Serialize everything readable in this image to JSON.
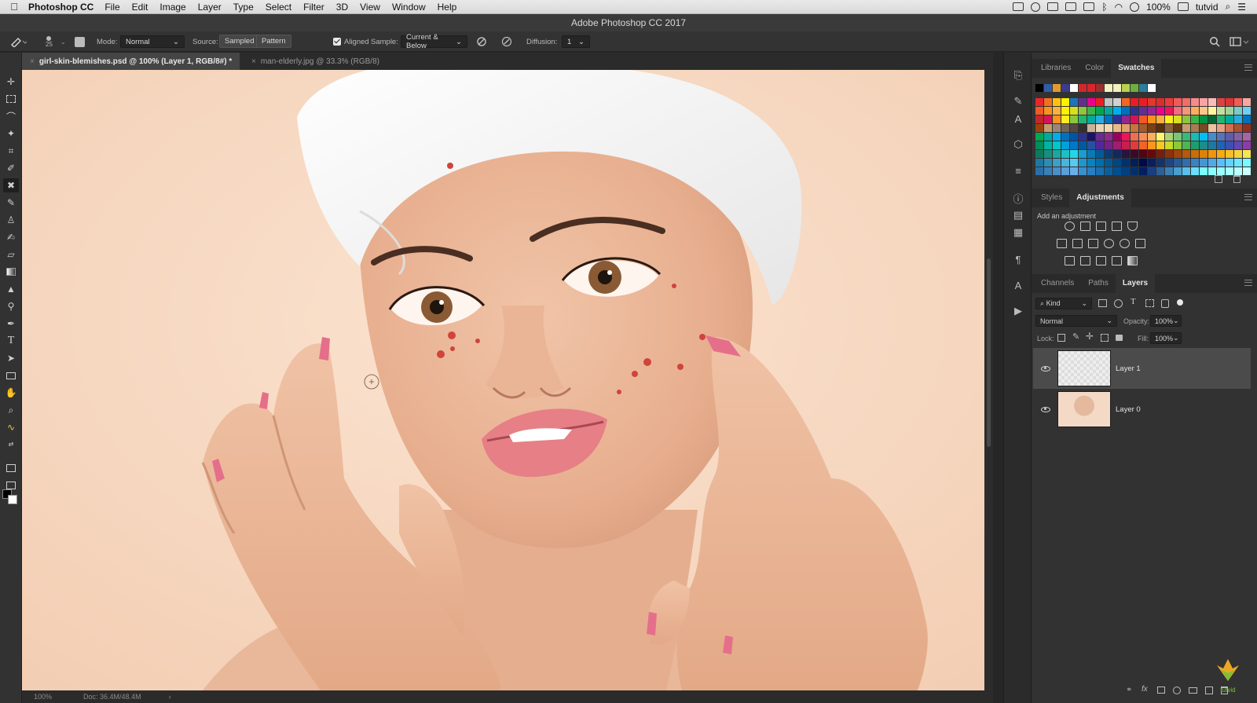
{
  "menubar": {
    "app_name": "Photoshop CC",
    "items": [
      "File",
      "Edit",
      "Image",
      "Layer",
      "Type",
      "Select",
      "Filter",
      "3D",
      "View",
      "Window",
      "Help"
    ],
    "battery": "100%",
    "user": "tutvid"
  },
  "window": {
    "title": "Adobe Photoshop CC 2017"
  },
  "options": {
    "brush_size": "25",
    "mode_label": "Mode:",
    "mode_value": "Normal",
    "source_label": "Source:",
    "source_sampled": "Sampled",
    "source_pattern": "Pattern",
    "aligned_label": "Aligned",
    "aligned_checked": true,
    "sample_label": "Sample:",
    "sample_value": "Current & Below",
    "diffusion_label": "Diffusion:",
    "diffusion_value": "1"
  },
  "tabs": [
    {
      "label": "girl-skin-blemishes.psd @ 100% (Layer 1, RGB/8#) *",
      "active": true
    },
    {
      "label": "man-elderly.jpg @ 33.3% (RGB/8)",
      "active": false
    }
  ],
  "status": {
    "zoom": "100%",
    "doc": "Doc: 36.4M/48.4M"
  },
  "swatches_panel": {
    "tabs": [
      "Libraries",
      "Color",
      "Swatches"
    ],
    "active": "Swatches",
    "colors": {
      "recent": [
        "#000000",
        "#2f5da8",
        "#e39a2d",
        "#3c3c8c",
        "#ffffff",
        "#d7262b",
        "#d7262b",
        "#9b2f2f",
        "#f5f0c0",
        "#f5f0c0",
        "#b8d24e",
        "#6cae3f",
        "#2e7d9a",
        "#ffffff"
      ],
      "rows": [
        [
          "#e9262b",
          "#f37021",
          "#ffc20e",
          "#fff200",
          "#1b75bc",
          "#662d91",
          "#ec008c",
          "#ed1c24",
          "#c2c2c2",
          "#d2d2d2",
          "#f26522",
          "#ed1c24",
          "#ed1c24",
          "#e4362c",
          "#e02b2b",
          "#e93c3c",
          "#f05a5a",
          "#f36b6b",
          "#f78a8a",
          "#f9a3a3",
          "#fcbcbc",
          "#e04040",
          "#d93535",
          "#f25c54",
          "#f7a7a0"
        ],
        [
          "#f15a24",
          "#f7941d",
          "#fbb040",
          "#fff200",
          "#d7df23",
          "#8dc63f",
          "#39b54a",
          "#00a651",
          "#00a99d",
          "#00aeef",
          "#0072bc",
          "#2e3192",
          "#662d91",
          "#92278f",
          "#ec008c",
          "#ed145b",
          "#f26d7d",
          "#f69679",
          "#fbaf5d",
          "#fdc689",
          "#fff799",
          "#c4df9b",
          "#a3d39c",
          "#7accc8",
          "#6dcff6"
        ],
        [
          "#c1272d",
          "#d4145a",
          "#f7931e",
          "#fcee21",
          "#8cc63f",
          "#22b573",
          "#00a99d",
          "#29abe2",
          "#0071bc",
          "#2e3192",
          "#93278f",
          "#d4145a",
          "#f15a24",
          "#f7931e",
          "#fbb03b",
          "#fcee21",
          "#d9e021",
          "#8cc63f",
          "#39b54a",
          "#009245",
          "#006837",
          "#22b573",
          "#00a99d",
          "#29abe2",
          "#0071bc"
        ],
        [
          "#a0410d",
          "#c69c6d",
          "#998675",
          "#736357",
          "#534741",
          "#362f2d",
          "#c7b299",
          "#ead5b5",
          "#f2d8b0",
          "#e9b98a",
          "#dfa06b",
          "#c7743d",
          "#a55a2a",
          "#7a3f16",
          "#5a2d0e",
          "#8c6239",
          "#603813",
          "#c69c6d",
          "#a67c52",
          "#754c24",
          "#f0c0a0",
          "#e8a080",
          "#d07050",
          "#b05030",
          "#903020"
        ],
        [
          "#00a651",
          "#00a99d",
          "#00aeef",
          "#0072bc",
          "#0054a6",
          "#2e3192",
          "#1b1464",
          "#662d91",
          "#92278f",
          "#9e005d",
          "#ed145b",
          "#f26c4f",
          "#f68e56",
          "#fbaf5d",
          "#fff568",
          "#acd373",
          "#7cc576",
          "#3cb878",
          "#1abbb4",
          "#00bff3",
          "#448ccb",
          "#5674b9",
          "#605ca8",
          "#8560a8",
          "#a864a8"
        ],
        [
          "#008c5a",
          "#00b4a0",
          "#00c8c8",
          "#00a0dc",
          "#0078c8",
          "#005aa0",
          "#2850a0",
          "#50289a",
          "#7a1e8c",
          "#a01e6e",
          "#c81e50",
          "#e03c3c",
          "#f06428",
          "#f8961e",
          "#f8c81e",
          "#c8dc28",
          "#8cc83c",
          "#50b450",
          "#1e9e6e",
          "#1e8c8c",
          "#1e78a0",
          "#1e64b4",
          "#3c50b4",
          "#6446b4",
          "#8c3caa"
        ],
        [
          "#0f7a5a",
          "#14917d",
          "#19a8a0",
          "#1ebfc3",
          "#23d6e6",
          "#14a0d2",
          "#0a7ab4",
          "#055a96",
          "#0a3c78",
          "#14285a",
          "#28143c",
          "#3c0a28",
          "#500514",
          "#640a0a",
          "#781e0a",
          "#8c320a",
          "#a0460a",
          "#b45a0a",
          "#c86e0a",
          "#dc820a",
          "#f0960a",
          "#f8aa14",
          "#f8be28",
          "#f8d23c",
          "#f8e650"
        ],
        [
          "#1e78a0",
          "#2d8cb4",
          "#3ca0c8",
          "#4bb4dc",
          "#5ac8f0",
          "#1e96d2",
          "#0a82be",
          "#006eaa",
          "#005a96",
          "#004682",
          "#00326e",
          "#001e5a",
          "#000a46",
          "#0a1e5a",
          "#14326e",
          "#1e4682",
          "#285a96",
          "#326eaa",
          "#3c82be",
          "#4696d2",
          "#50aae6",
          "#5abefa",
          "#64d2ff",
          "#6ee6ff",
          "#78faff"
        ],
        [
          "#2b6fa8",
          "#3a7fb8",
          "#4a8fc8",
          "#5a9fd8",
          "#6aafe8",
          "#3a8fd0",
          "#2a7fc0",
          "#1a6fb0",
          "#0a5fa0",
          "#004f90",
          "#003f80",
          "#002f70",
          "#001f60",
          "#1a3f80",
          "#2a5f9a",
          "#3a7fb4",
          "#4a9fce",
          "#5abfe8",
          "#6adfff",
          "#7affff",
          "#8affff",
          "#9affff",
          "#aaffff",
          "#baffff",
          "#caffff"
        ]
      ]
    }
  },
  "adjustments_panel": {
    "tabs": [
      "Styles",
      "Adjustments"
    ],
    "active": "Adjustments",
    "heading": "Add an adjustment"
  },
  "layers_panel": {
    "tabs": [
      "Channels",
      "Paths",
      "Layers"
    ],
    "active": "Layers",
    "filter_kind": "Kind",
    "blend_mode": "Normal",
    "opacity_label": "Opacity:",
    "opacity_value": "100%",
    "lock_label": "Lock:",
    "fill_label": "Fill:",
    "fill_value": "100%",
    "layers": [
      {
        "name": "Layer 1",
        "visible": true,
        "selected": true
      },
      {
        "name": "Layer 0",
        "visible": true,
        "selected": false
      }
    ]
  },
  "watermark": "tutvid"
}
